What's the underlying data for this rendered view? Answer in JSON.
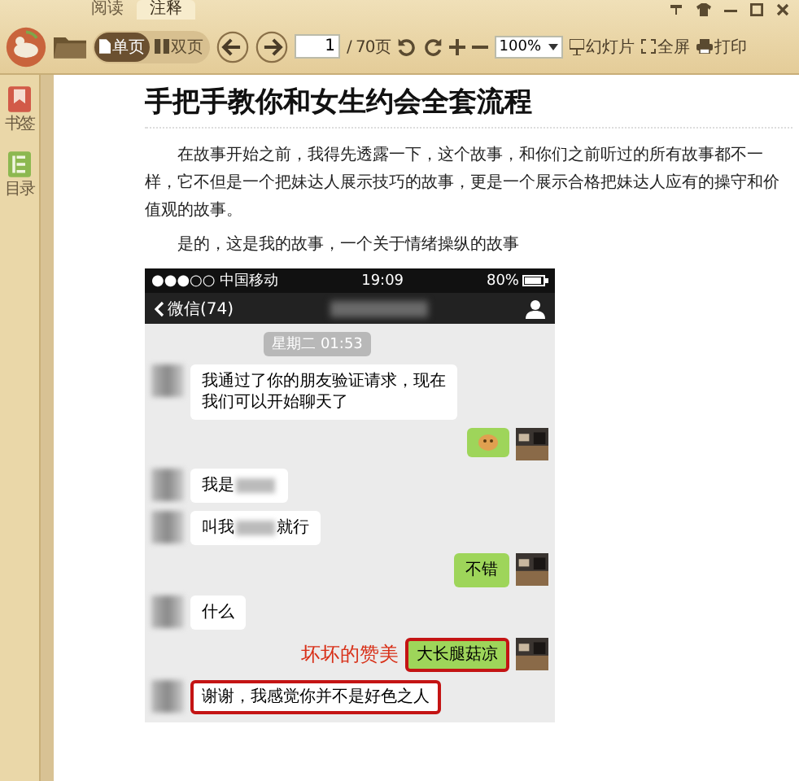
{
  "tabs": [
    {
      "label": "阅读",
      "selected": false
    },
    {
      "label": "注释",
      "selected": true
    }
  ],
  "toolbar": {
    "view_modes": [
      {
        "label": "单页",
        "selected": true
      },
      {
        "label": "双页",
        "selected": false
      }
    ],
    "page_input": "1",
    "page_total": "/ 70页",
    "zoom": "100%",
    "actions": [
      {
        "kind": "slides",
        "label": "幻灯片"
      },
      {
        "kind": "fullscreen",
        "label": "全屏"
      },
      {
        "kind": "print",
        "label": "打印"
      }
    ]
  },
  "sidebar": {
    "items": [
      {
        "kind": "bookmark",
        "label": "书签"
      },
      {
        "kind": "contents",
        "label": "目录"
      }
    ]
  },
  "document": {
    "title": "手把手教你和女生约会全套流程",
    "paragraphs": [
      "在故事开始之前，我得先透露一下，这个故事，和你们之前听过的所有故事都不一样，它不但是一个把妹达人展示技巧的故事，更是一个展示合格把妹达人应有的操守和价值观的故事。",
      "是的，这是我的故事，一个关于情绪操纵的故事"
    ]
  },
  "chat": {
    "carrier": "●●●○○ 中国移动",
    "time": "19:09",
    "battery": "80%",
    "back": "微信(74)",
    "date": "星期二 01:53",
    "messages": [
      {
        "kind": "incoming",
        "text": "我通过了你的朋友验证请求，现在我们可以开始聊天了",
        "redacted": false,
        "highlighted": false
      },
      {
        "kind": "sticker",
        "highlighted": false
      },
      {
        "kind": "incoming",
        "text": "我是",
        "redacted": true,
        "highlighted": false
      },
      {
        "kind": "incoming",
        "text": "叫我",
        "redacted": true,
        "text_after": "就行",
        "highlighted": false
      },
      {
        "kind": "outgoing",
        "text": "不错",
        "highlighted": false
      },
      {
        "kind": "incoming",
        "text": "什么",
        "redacted": false,
        "highlighted": false
      },
      {
        "kind": "outgoing",
        "text": "大长腿菇凉",
        "highlighted": true,
        "annotation": "坏坏的赞美"
      },
      {
        "kind": "incoming",
        "text": "谢谢，我感觉你并不是好色之人",
        "redacted": false,
        "highlighted": true
      }
    ]
  }
}
